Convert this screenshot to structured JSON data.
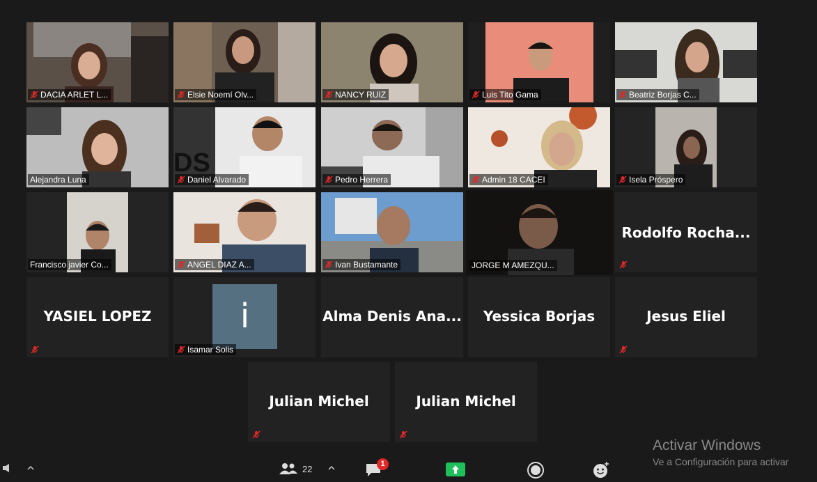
{
  "participants": {
    "row1": [
      "DACIA ARLET L...",
      "Elsie Noemí Olv...",
      "NANCY RUIZ",
      "Luis Tito Gama",
      "Beatriz Borjas C..."
    ],
    "row2": [
      "Alejandra Luna",
      "Daniel Alvarado",
      "Pedro Herrera",
      "Admin 18 CACEI",
      "Isela Próspero"
    ],
    "row3": [
      "Francisco javier Co...",
      "ANGEL DIAZ A...",
      "Ivan Bustamante",
      "JORGE M AMEZQU...",
      "Rodolfo  Rocha..."
    ],
    "row4": [
      "YASIEL LOPEZ",
      "Isamar Solis",
      "Alma  Denis  Ana...",
      "Yessica Borjas",
      "Jesus Eliel"
    ],
    "row5": [
      "Julian Michel",
      "Julian Michel"
    ],
    "avatar_letter": "i"
  },
  "toolbar": {
    "participant_count": "22",
    "chat_badge": "1"
  },
  "watermark": {
    "line1": "Activar Windows",
    "line2": "Ve a Configuración para activar"
  },
  "colors": {
    "active_speaker_border": "#c9e05a",
    "mute_red": "#e02828",
    "share_green": "#1fbf5a"
  }
}
